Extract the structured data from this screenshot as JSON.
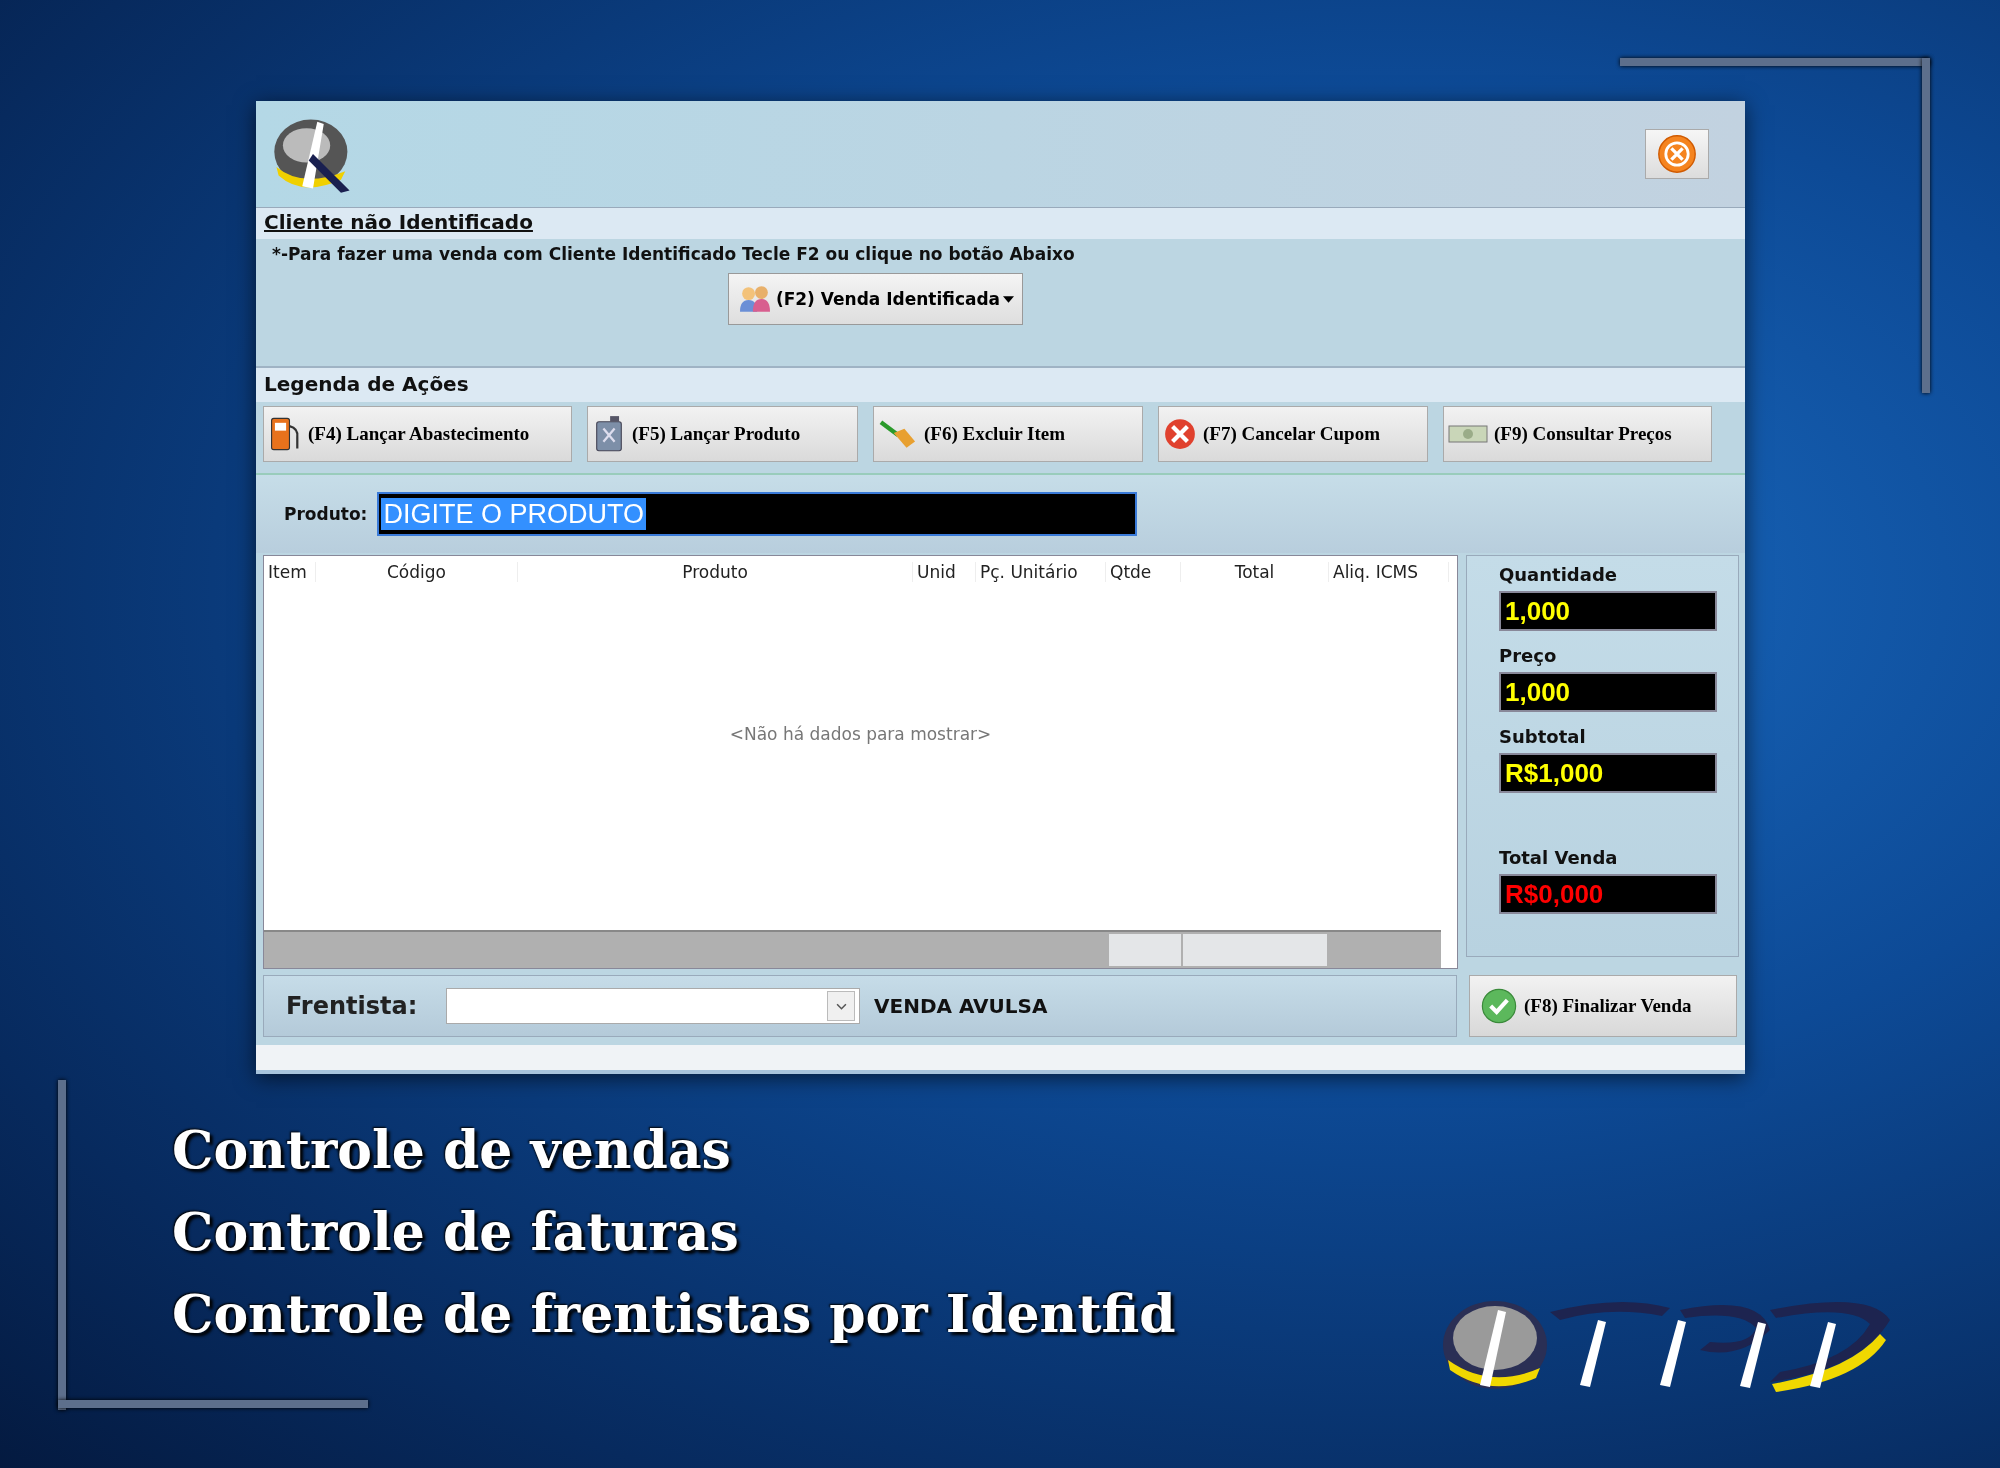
{
  "client_section": {
    "title": "Cliente não Identificado",
    "hint": "*-Para fazer uma venda com Cliente Identificado Tecle F2 ou clique no botão Abaixo",
    "button": "(F2) Venda Identificada"
  },
  "actions": {
    "title": "Legenda de Ações",
    "buttons": [
      {
        "kind": "fuel",
        "label": "(F4) Lançar Abastecimento"
      },
      {
        "kind": "canister",
        "label": "(F5) Lançar Produto"
      },
      {
        "kind": "broom",
        "label": "(F6) Excluir Item"
      },
      {
        "kind": "cancel",
        "label": "(F7) Cancelar Cupom"
      },
      {
        "kind": "money",
        "label": "(F9) Consultar Preços"
      }
    ]
  },
  "product_field": {
    "label": "Produto:",
    "value": "DIGITE O PRODUTO"
  },
  "table": {
    "columns": [
      "Item",
      "Código",
      "Produto",
      "Unid",
      "Pç. Unitário",
      "Qtde",
      "Total",
      "Aliq. ICMS"
    ],
    "empty_message": "<Não há dados para mostrar>"
  },
  "totals": [
    {
      "label": "Quantidade",
      "value": "1,000",
      "color": "#ffff00"
    },
    {
      "label": "Preço",
      "value": "1,000",
      "color": "#ffff00"
    },
    {
      "label": "Subtotal",
      "value": "R$1,000",
      "color": "#ffff00"
    },
    {
      "label": "Total Venda",
      "value": "R$0,000",
      "color": "#ff0000"
    }
  ],
  "attendant": {
    "label": "Frentista:",
    "sale_type": "VENDA AVULSA"
  },
  "finish_button": "(F8) Finalizar Venda",
  "captions": [
    "Controle de vendas",
    "Controle de faturas",
    "Controle de frentistas por Identfid"
  ]
}
